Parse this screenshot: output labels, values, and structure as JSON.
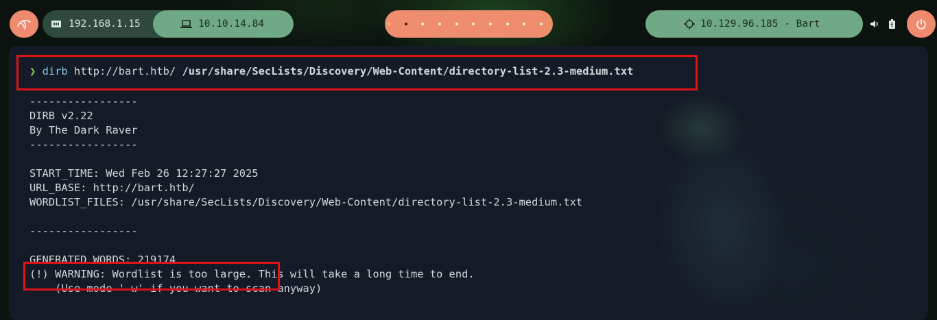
{
  "topbar": {
    "logo_icon": "kali-dragon-icon",
    "local_ip": "192.168.1.15",
    "vpn_ip": "10.10.14.84",
    "workspace_count": 10,
    "active_workspace": 2,
    "target": "10.129.96.185 - Bart",
    "colors": {
      "salmon": "#ee8a6e",
      "green": "#6fa985",
      "dark_green": "#2f4a3d"
    }
  },
  "terminal": {
    "prompt_symbol": "❯",
    "command": "dirb",
    "arg_url": "http://bart.htb/",
    "arg_wordlist": "/usr/share/SecLists/Discovery/Web-Content/directory-list-2.3-medium.txt",
    "output": [
      "-----------------",
      "DIRB v2.22",
      "By The Dark Raver",
      "-----------------",
      "",
      "START_TIME: Wed Feb 26 12:27:27 2025",
      "URL_BASE: http://bart.htb/",
      "WORDLIST_FILES: /usr/share/SecLists/Discovery/Web-Content/directory-list-2.3-medium.txt",
      "",
      "-----------------",
      "",
      "GENERATED WORDS: 219174",
      "(!) WARNING: Wordlist is too large. This will take a long time to end.",
      "    (Use mode '-w' if you want to scan anyway)"
    ]
  }
}
